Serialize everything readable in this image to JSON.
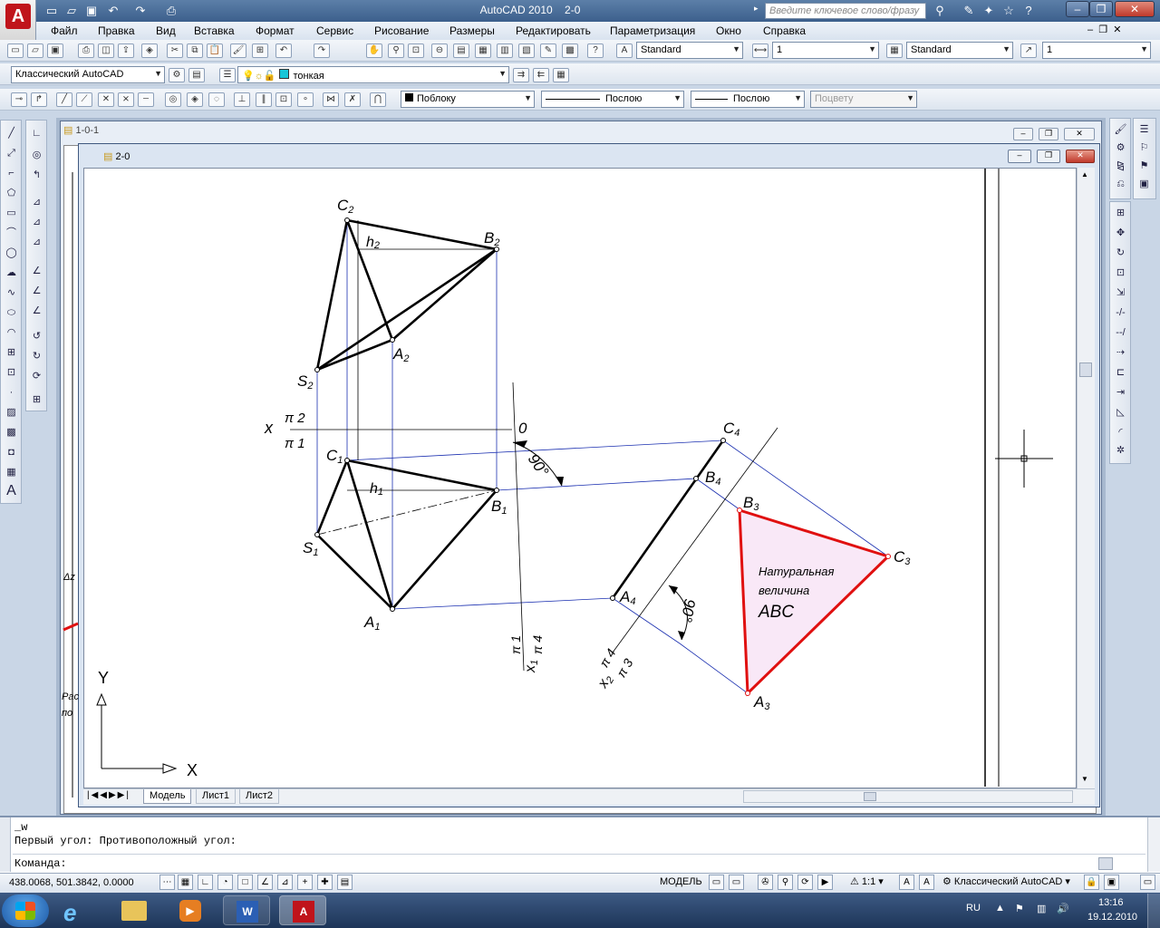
{
  "app": {
    "title": "AutoCAD 2010",
    "doc_name": "2-0",
    "search_placeholder": "Введите ключевое слово/фразу"
  },
  "menu": [
    "Файл",
    "Правка",
    "Вид",
    "Вставка",
    "Формат",
    "Сервис",
    "Рисование",
    "Размеры",
    "Редактировать",
    "Параметризация",
    "Окно",
    "Справка"
  ],
  "toolbar2": {
    "text_style": "Standard",
    "scale": "1",
    "table_style": "Standard",
    "mleader_scale": "1"
  },
  "toolbar3": {
    "workspace": "Классический AutoCAD",
    "layer": "тонкая"
  },
  "toolbar4": {
    "color": "Поблоку",
    "linetype": "Послою",
    "lineweight": "Послою",
    "plotstyle": "Поцвету"
  },
  "drawing_windows": {
    "back_title": "1-0-1",
    "front_title": "2-0"
  },
  "tabs": [
    "Модель",
    "Лист1",
    "Лист2"
  ],
  "drawing_labels": {
    "C2": "C",
    "C2s": "2",
    "B2": "B",
    "B2s": "2",
    "h2": "h",
    "h2s": "2",
    "A2": "A",
    "A2s": "2",
    "S2": "S",
    "S2s": "2",
    "x": "x",
    "pi2": "π 2",
    "pi1": "π 1",
    "zero": "0",
    "C1": "C",
    "C1s": "1",
    "h1": "h",
    "h1s": "1",
    "B1": "B",
    "B1s": "1",
    "S1": "S",
    "S1s": "1",
    "A1": "A",
    "A1s": "1",
    "angle1": "90°",
    "angle2": "90°",
    "C4": "C",
    "C4s": "4",
    "B4": "B",
    "B4s": "4",
    "A4": "A",
    "A4s": "4",
    "B3": "B",
    "B3s": "3",
    "C3": "C",
    "C3s": "3",
    "A3": "A",
    "A3s": "3",
    "x1_axis": "x",
    "x1_sub": "1",
    "x1_pi1": "π 1",
    "x1_pi4": "π 4",
    "x2_axis": "x",
    "x2_sub": "2",
    "x2_pi4": "π 4",
    "x2_pi3": "π 3",
    "natural1": "Натуральная",
    "natural2": "величина",
    "natural3": "ABC",
    "ucs_y": "Y",
    "ucs_x": "X"
  },
  "command": {
    "line1": "_w",
    "line2": "Первый угол: Противоположный угол:",
    "prompt": "Команда:"
  },
  "status": {
    "coords": "438.0068, 501.3842, 0.0000",
    "model": "МОДЕЛЬ",
    "scale": "1:1",
    "workspace": "Классический AutoCAD"
  },
  "tray": {
    "lang": "RU",
    "time": "13:16",
    "date": "19.12.2010"
  },
  "colors": {
    "accent_red": "#e01010",
    "construction_blue": "#1a2fb0",
    "natural_fill": "#f9e8f7"
  }
}
